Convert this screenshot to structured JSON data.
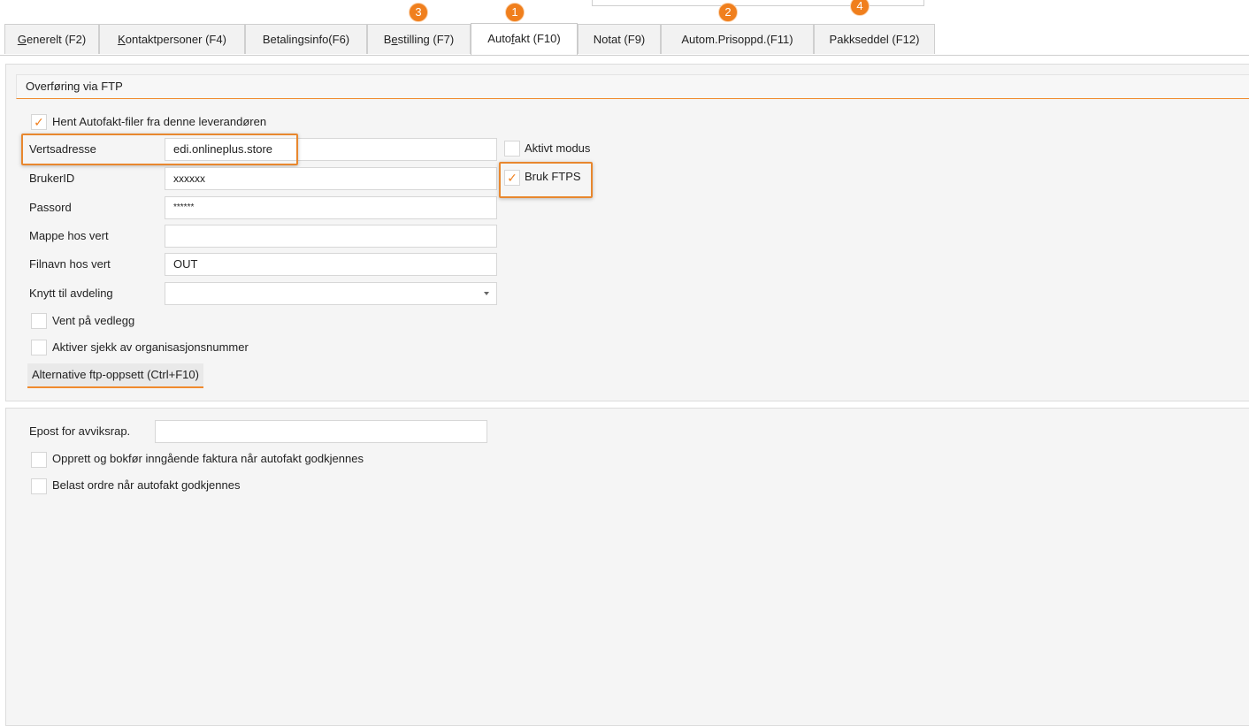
{
  "tabs": [
    {
      "label_pre": "",
      "label_ul": "G",
      "label_post": "enerelt (F2)",
      "active": false
    },
    {
      "label_pre": "",
      "label_ul": "K",
      "label_post": "ontaktpersoner (F4)",
      "active": false
    },
    {
      "label_pre": "Betalingsinfo(F6)",
      "label_ul": "",
      "label_post": "",
      "active": false
    },
    {
      "label_pre": "B",
      "label_ul": "e",
      "label_post": "stilling (F7)",
      "active": false
    },
    {
      "label_pre": "Auto",
      "label_ul": "f",
      "label_post": "akt (F10)",
      "active": true
    },
    {
      "label_pre": "Notat (F9)",
      "label_ul": "",
      "label_post": "",
      "active": false
    },
    {
      "label_pre": "Autom.Prisoppd.(F11)",
      "label_ul": "",
      "label_post": "",
      "active": false
    },
    {
      "label_pre": "Pakkseddel (F12)",
      "label_ul": "",
      "label_post": "",
      "active": false
    }
  ],
  "badges": [
    "3",
    "1",
    "2",
    "4"
  ],
  "ftp": {
    "section_title": "Overføring via FTP",
    "fetch_checkbox": {
      "label": "Hent Autofakt-filer fra denne leverandøren",
      "checked": true
    },
    "host": {
      "label": "Vertsadresse",
      "value": "edi.onlineplus.store"
    },
    "user": {
      "label": "BrukerID",
      "value": "xxxxxx"
    },
    "password": {
      "label": "Passord",
      "value": "******"
    },
    "folder": {
      "label": "Mappe hos vert",
      "value": ""
    },
    "filename": {
      "label": "Filnavn hos vert",
      "value": "OUT"
    },
    "department": {
      "label": "Knytt til avdeling",
      "value": ""
    },
    "active_mode": {
      "label": "Aktivt modus",
      "checked": false
    },
    "ftps": {
      "label": "Bruk FTPS",
      "checked": true
    },
    "wait_attachment": {
      "label": "Vent på vedlegg",
      "checked": false
    },
    "org_check": {
      "label": "Aktiver sjekk av organisasjonsnummer",
      "checked": false
    },
    "alt_button": "Alternative ftp-oppsett (Ctrl+F10)"
  },
  "report": {
    "email": {
      "label": "Epost for avviksrap.",
      "value": ""
    },
    "create_invoice": {
      "label": "Opprett og bokfør inngående faktura når autofakt godkjennes",
      "checked": false
    },
    "charge_order": {
      "label": "Belast ordre når autofakt godkjennes",
      "checked": false
    }
  },
  "checkmark_glyph": "✓",
  "colors": {
    "accent": "#f07f1d",
    "panel": "#f5f5f5",
    "border": "#cfcfcf"
  }
}
